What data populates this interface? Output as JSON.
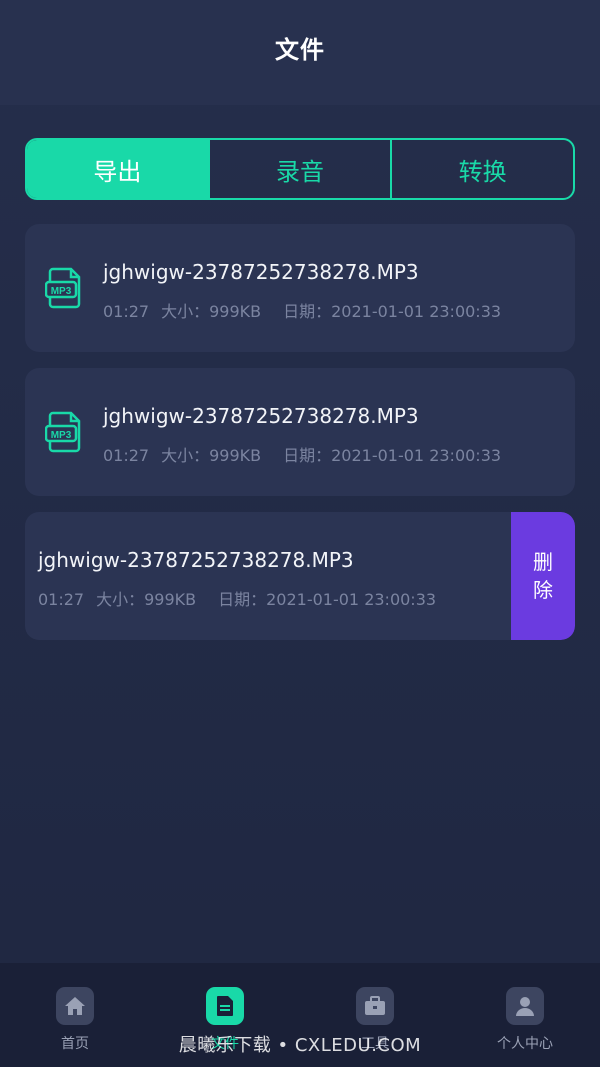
{
  "header": {
    "title": "文件"
  },
  "tabs": [
    {
      "label": "导出",
      "active": true
    },
    {
      "label": "录音",
      "active": false
    },
    {
      "label": "转换",
      "active": false
    }
  ],
  "files": [
    {
      "name": "jghwigw-23787252738278.MP3",
      "duration": "01:27",
      "size": "大小：999KB",
      "date": "日期：2021-01-01 23:00:33",
      "icon": "mp3-file-icon",
      "icon_text": "MP3"
    },
    {
      "name": "jghwigw-23787252738278.MP3",
      "duration": "01:27",
      "size": "大小：999KB",
      "date": "日期：2021-01-01 23:00:33",
      "icon": "mp3-file-icon",
      "icon_text": "MP3"
    },
    {
      "name": "jghwigw-23787252738278.MP3",
      "duration": "01:27",
      "size": "大小：999KB",
      "date": "日期：2021-01-01 23:00:33",
      "swiped": true
    }
  ],
  "delete_action": {
    "line1": "删",
    "line2": "除"
  },
  "bottom_nav": [
    {
      "label": "首页",
      "icon": "home-icon",
      "active": false
    },
    {
      "label": "文件",
      "icon": "file-icon",
      "active": true
    },
    {
      "label": "工具",
      "icon": "toolbox-icon",
      "active": false
    },
    {
      "label": "个人中心",
      "icon": "user-icon",
      "active": false
    }
  ],
  "watermark": "晨曦乐下载 • CXLEDU.COM",
  "colors": {
    "accent": "#19d9a8",
    "delete": "#6b3be0",
    "background": "#212a44",
    "card": "#2b3453"
  }
}
